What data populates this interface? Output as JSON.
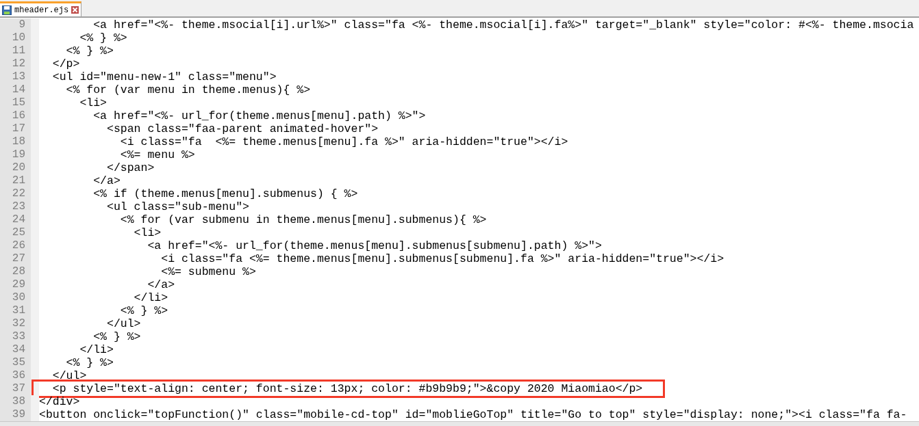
{
  "tabs": [
    {
      "label": "mheader.ejs",
      "selected": true
    }
  ],
  "editor": {
    "lines": [
      {
        "number": "9",
        "text": "        <a href=\"<%- theme.msocial[i].url%>\" class=\"fa <%- theme.msocial[i].fa%>\" target=\"_blank\" style=\"color: #<%- theme.msocia"
      },
      {
        "number": "10",
        "text": "      <% } %>"
      },
      {
        "number": "11",
        "text": "    <% } %>"
      },
      {
        "number": "12",
        "text": "  </p>"
      },
      {
        "number": "13",
        "text": "  <ul id=\"menu-new-1\" class=\"menu\">"
      },
      {
        "number": "14",
        "text": "    <% for (var menu in theme.menus){ %>"
      },
      {
        "number": "15",
        "text": "      <li>"
      },
      {
        "number": "16",
        "text": "        <a href=\"<%- url_for(theme.menus[menu].path) %>\">"
      },
      {
        "number": "17",
        "text": "          <span class=\"faa-parent animated-hover\">"
      },
      {
        "number": "18",
        "text": "            <i class=\"fa  <%= theme.menus[menu].fa %>\" aria-hidden=\"true\"></i>"
      },
      {
        "number": "19",
        "text": "            <%= menu %>"
      },
      {
        "number": "20",
        "text": "          </span>"
      },
      {
        "number": "21",
        "text": "        </a>"
      },
      {
        "number": "22",
        "text": "        <% if (theme.menus[menu].submenus) { %>"
      },
      {
        "number": "23",
        "text": "          <ul class=\"sub-menu\">"
      },
      {
        "number": "24",
        "text": "            <% for (var submenu in theme.menus[menu].submenus){ %>"
      },
      {
        "number": "25",
        "text": "              <li>"
      },
      {
        "number": "26",
        "text": "                <a href=\"<%- url_for(theme.menus[menu].submenus[submenu].path) %>\">"
      },
      {
        "number": "27",
        "text": "                  <i class=\"fa <%= theme.menus[menu].submenus[submenu].fa %>\" aria-hidden=\"true\"></i>"
      },
      {
        "number": "28",
        "text": "                  <%= submenu %>"
      },
      {
        "number": "29",
        "text": "                </a>"
      },
      {
        "number": "30",
        "text": "              </li>"
      },
      {
        "number": "31",
        "text": "            <% } %>"
      },
      {
        "number": "32",
        "text": "          </ul>"
      },
      {
        "number": "33",
        "text": "        <% } %>"
      },
      {
        "number": "34",
        "text": "      </li>"
      },
      {
        "number": "35",
        "text": "    <% } %>"
      },
      {
        "number": "36",
        "text": "  </ul>"
      },
      {
        "number": "37",
        "highlighted": true,
        "text": "  <p style=\"text-align: center; font-size: 13px; color: #b9b9b9;\">&copy 2020 Miaomiao</p>"
      },
      {
        "number": "38",
        "text": "</div>"
      },
      {
        "number": "39",
        "text": "<button onclick=\"topFunction()\" class=\"mobile-cd-top\" id=\"moblieGoTop\" title=\"Go to top\" style=\"display: none;\"><i class=\"fa fa-"
      }
    ]
  }
}
